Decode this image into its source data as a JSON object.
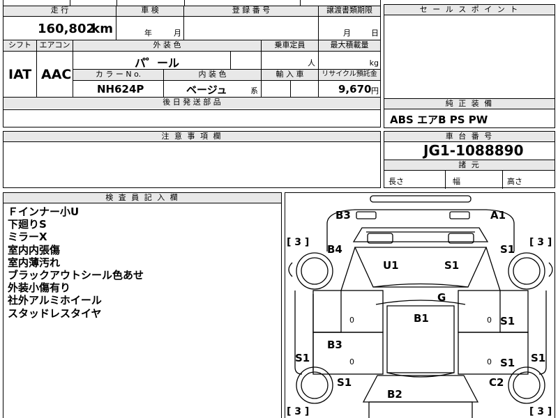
{
  "top": {
    "mileage_header": "走 行",
    "inspection_header": "車 検",
    "registration_header": "登 録 番 号",
    "transfer_header": "譲渡書類期限",
    "mileage_value": "160,802",
    "mileage_unit": "km",
    "inspection_year": "年",
    "inspection_month": "月",
    "transfer_month": "月",
    "transfer_day": "日",
    "shift_header": "シフト",
    "ac_header": "エアコン",
    "color_header": "外 装 色",
    "capacity_header": "乗車定員",
    "load_header": "最大積載量",
    "color_value": "パ゜ール",
    "capacity_unit": "人",
    "load_unit": "kg",
    "colorno_header": "カ ラ ー  N o.",
    "interior_header": "内 装 色",
    "import_header": "輸 入 車",
    "recycle_header": "リサイクル預託金",
    "shift_value": "IAT",
    "ac_value": "AAC",
    "colorno_value": "NH624P",
    "interior_value": "ベージュ",
    "interior_suffix": "系",
    "recycle_value": "9,670",
    "recycle_unit": "円",
    "later_parts_header": "後 日 発 送 部 品"
  },
  "sales_point": {
    "header": "セ ー ル ス ポ イ ン ト"
  },
  "equipment": {
    "header": "純 正 装 備",
    "value": "ABS エアB PS PW"
  },
  "notes": {
    "header": "注 意 事 項 欄"
  },
  "chassis": {
    "header": "車 台 番 号",
    "value": "JG1-1088890"
  },
  "dimensions": {
    "header": "諸 元",
    "length": "長さ",
    "width": "幅",
    "height": "高さ"
  },
  "inspector": {
    "header": "検 査 員 記 入 欄",
    "lines": [
      "Ｆインナー小U",
      "下廻りS",
      "ミラーX",
      "室内内張傷",
      "室内薄汚れ",
      "ブラックアウトシール色あせ",
      "外装小傷有り",
      "社外アルミホイール",
      "スタッドレスタイヤ"
    ]
  },
  "diagram_marks": {
    "b3_top": "B3",
    "a1": "A1",
    "b4": "B4",
    "s1_right_top": "S1",
    "u1": "U1",
    "s1_roof": "S1",
    "g": "G",
    "b1": "B1",
    "s1_right_mid": "S1",
    "b3_left": "B3",
    "s1_left": "S1",
    "s1_right_low": "S1",
    "s1_far_right": "S1",
    "s1_left_wheel": "S1",
    "c2": "C2",
    "b2": "B2",
    "bracket_tl": "[ 3 ]",
    "bracket_tr": "[ 3 ]",
    "bracket_bl": "[ 3 ]",
    "bracket_br": "[ 3 ]",
    "tire_zero": "0"
  }
}
